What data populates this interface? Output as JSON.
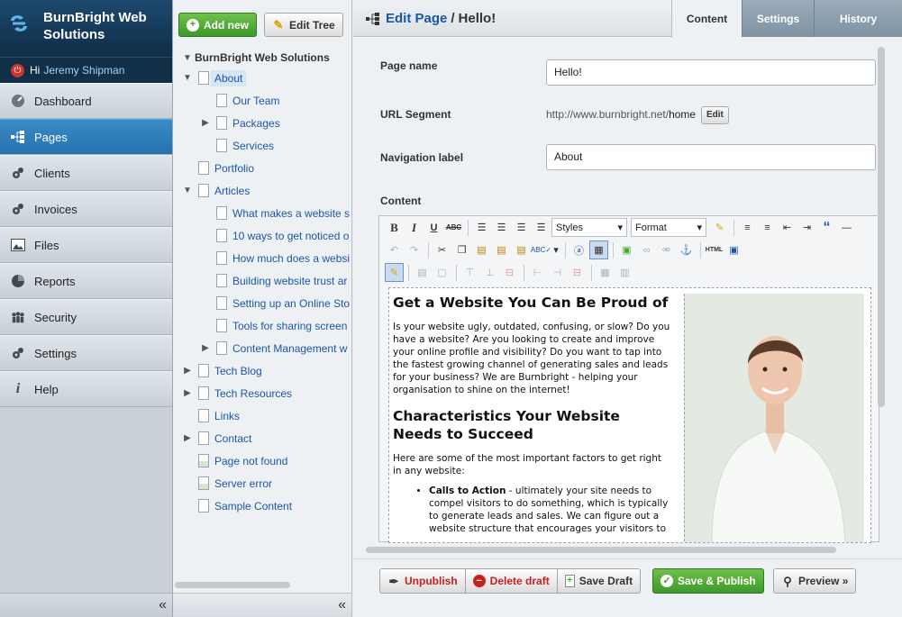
{
  "brand": {
    "name_line1": "BurnBright Web",
    "name_line2": "Solutions"
  },
  "user": {
    "greeting": "Hi",
    "name": "Jeremy Shipman"
  },
  "nav": {
    "items": [
      {
        "label": "Dashboard",
        "icon": "dashboard-icon"
      },
      {
        "label": "Pages",
        "icon": "sitemap-icon",
        "active": true
      },
      {
        "label": "Clients",
        "icon": "gears-icon"
      },
      {
        "label": "Invoices",
        "icon": "gears-icon"
      },
      {
        "label": "Files",
        "icon": "image-icon"
      },
      {
        "label": "Reports",
        "icon": "pie-chart-icon"
      },
      {
        "label": "Security",
        "icon": "people-icon"
      },
      {
        "label": "Settings",
        "icon": "gears-icon"
      },
      {
        "label": "Help",
        "icon": "info-icon"
      }
    ],
    "collapse_glyph": "«"
  },
  "tree": {
    "add_new_label": "Add new",
    "edit_tree_label": "Edit Tree",
    "root_label": "BurnBright Web Solutions",
    "rows": [
      {
        "label": "About",
        "depth": 1,
        "toggle": "▼",
        "selected": true
      },
      {
        "label": "Our Team",
        "depth": 2,
        "toggle": ""
      },
      {
        "label": "Packages",
        "depth": 2,
        "toggle": "▶"
      },
      {
        "label": "Services",
        "depth": 2,
        "toggle": ""
      },
      {
        "label": "Portfolio",
        "depth": 1,
        "toggle": ""
      },
      {
        "label": "Articles",
        "depth": 1,
        "toggle": "▼"
      },
      {
        "label": "What makes a website s",
        "depth": 2,
        "toggle": ""
      },
      {
        "label": "10 ways to get noticed o",
        "depth": 2,
        "toggle": ""
      },
      {
        "label": "How much does a websi",
        "depth": 2,
        "toggle": ""
      },
      {
        "label": "Building website trust ar",
        "depth": 2,
        "toggle": ""
      },
      {
        "label": "Setting up an Online Sto",
        "depth": 2,
        "toggle": ""
      },
      {
        "label": "Tools for sharing screen",
        "depth": 2,
        "toggle": ""
      },
      {
        "label": "Content Management w",
        "depth": 2,
        "toggle": "▶"
      },
      {
        "label": "Tech Blog",
        "depth": 1,
        "toggle": "▶"
      },
      {
        "label": "Tech Resources",
        "depth": 1,
        "toggle": "▶"
      },
      {
        "label": "Links",
        "depth": 1,
        "toggle": ""
      },
      {
        "label": "Contact",
        "depth": 1,
        "toggle": "▶"
      },
      {
        "label": "Page not found",
        "depth": 1,
        "toggle": "",
        "error_page": true
      },
      {
        "label": "Server error",
        "depth": 1,
        "toggle": "",
        "error_page": true
      },
      {
        "label": "Sample Content",
        "depth": 1,
        "toggle": ""
      }
    ],
    "collapse_glyph": "«"
  },
  "header": {
    "crumb_link": "Edit Page",
    "crumb_sep": "/",
    "crumb_current": "Hello!",
    "tabs": [
      {
        "label": "Content",
        "active": true
      },
      {
        "label": "Settings"
      },
      {
        "label": "History"
      }
    ]
  },
  "form": {
    "page_name_label": "Page name",
    "page_name_value": "Hello!",
    "url_label": "URL Segment",
    "url_base": "http://www.burnbright.net/",
    "url_slug": "home",
    "url_edit_label": "Edit",
    "nav_label_label": "Navigation label",
    "nav_label_value": "About",
    "content_label": "Content",
    "styles_select": "Styles",
    "format_select": "Format"
  },
  "content": {
    "heading1": "Get a Website You Can Be Proud of",
    "para1": "Is your website ugly, outdated, confusing, or slow? Do you have a website? Are you looking to create and improve your online profile and visibility? Do you want to tap into the fastest growing channel of generating sales and leads for your business? We are Burnbright - helping your organisation to shine on the internet!",
    "heading2": "Characteristics Your Website Needs to Succeed",
    "para2": "Here are some of the most important factors to get right in any website:",
    "bullet_bold": "Calls to Action",
    "bullet_text": " - ultimately your site needs to compel visitors to do something, which is typically to generate leads and sales. We can figure out a website structure that encourages your visitors to"
  },
  "actions": {
    "unpublish": "Unpublish",
    "delete_draft": "Delete draft",
    "save_draft": "Save Draft",
    "save_publish": "Save & Publish",
    "preview": "Preview »"
  },
  "colors": {
    "nav_active": "#2f7fbd",
    "link": "#1a56a8",
    "publish_green": "#4aa832",
    "danger_red": "#c8201d"
  }
}
